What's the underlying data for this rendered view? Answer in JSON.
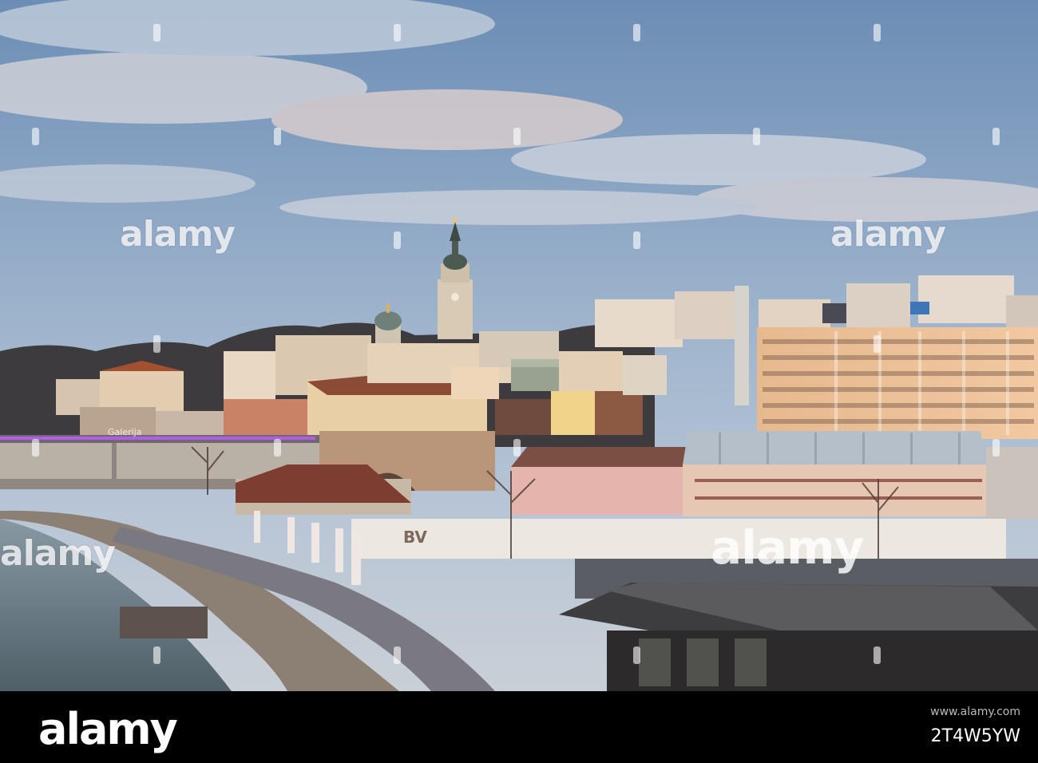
{
  "watermark": {
    "brand": "alamy"
  },
  "footer": {
    "logo": "alamy",
    "url": "www.alamy.com",
    "image_id": "2T4W5YW"
  },
  "scene_text": {
    "bridge_sign": "Galerija",
    "shop_sign": "BV"
  },
  "colors": {
    "sky_top": "#6f8fb5",
    "sky_mid": "#9fb5cf",
    "sky_warm": "#e8cfc4",
    "river": "#6a7c86",
    "bridge_light": "#b35ce8",
    "footer_bg": "#000000"
  }
}
